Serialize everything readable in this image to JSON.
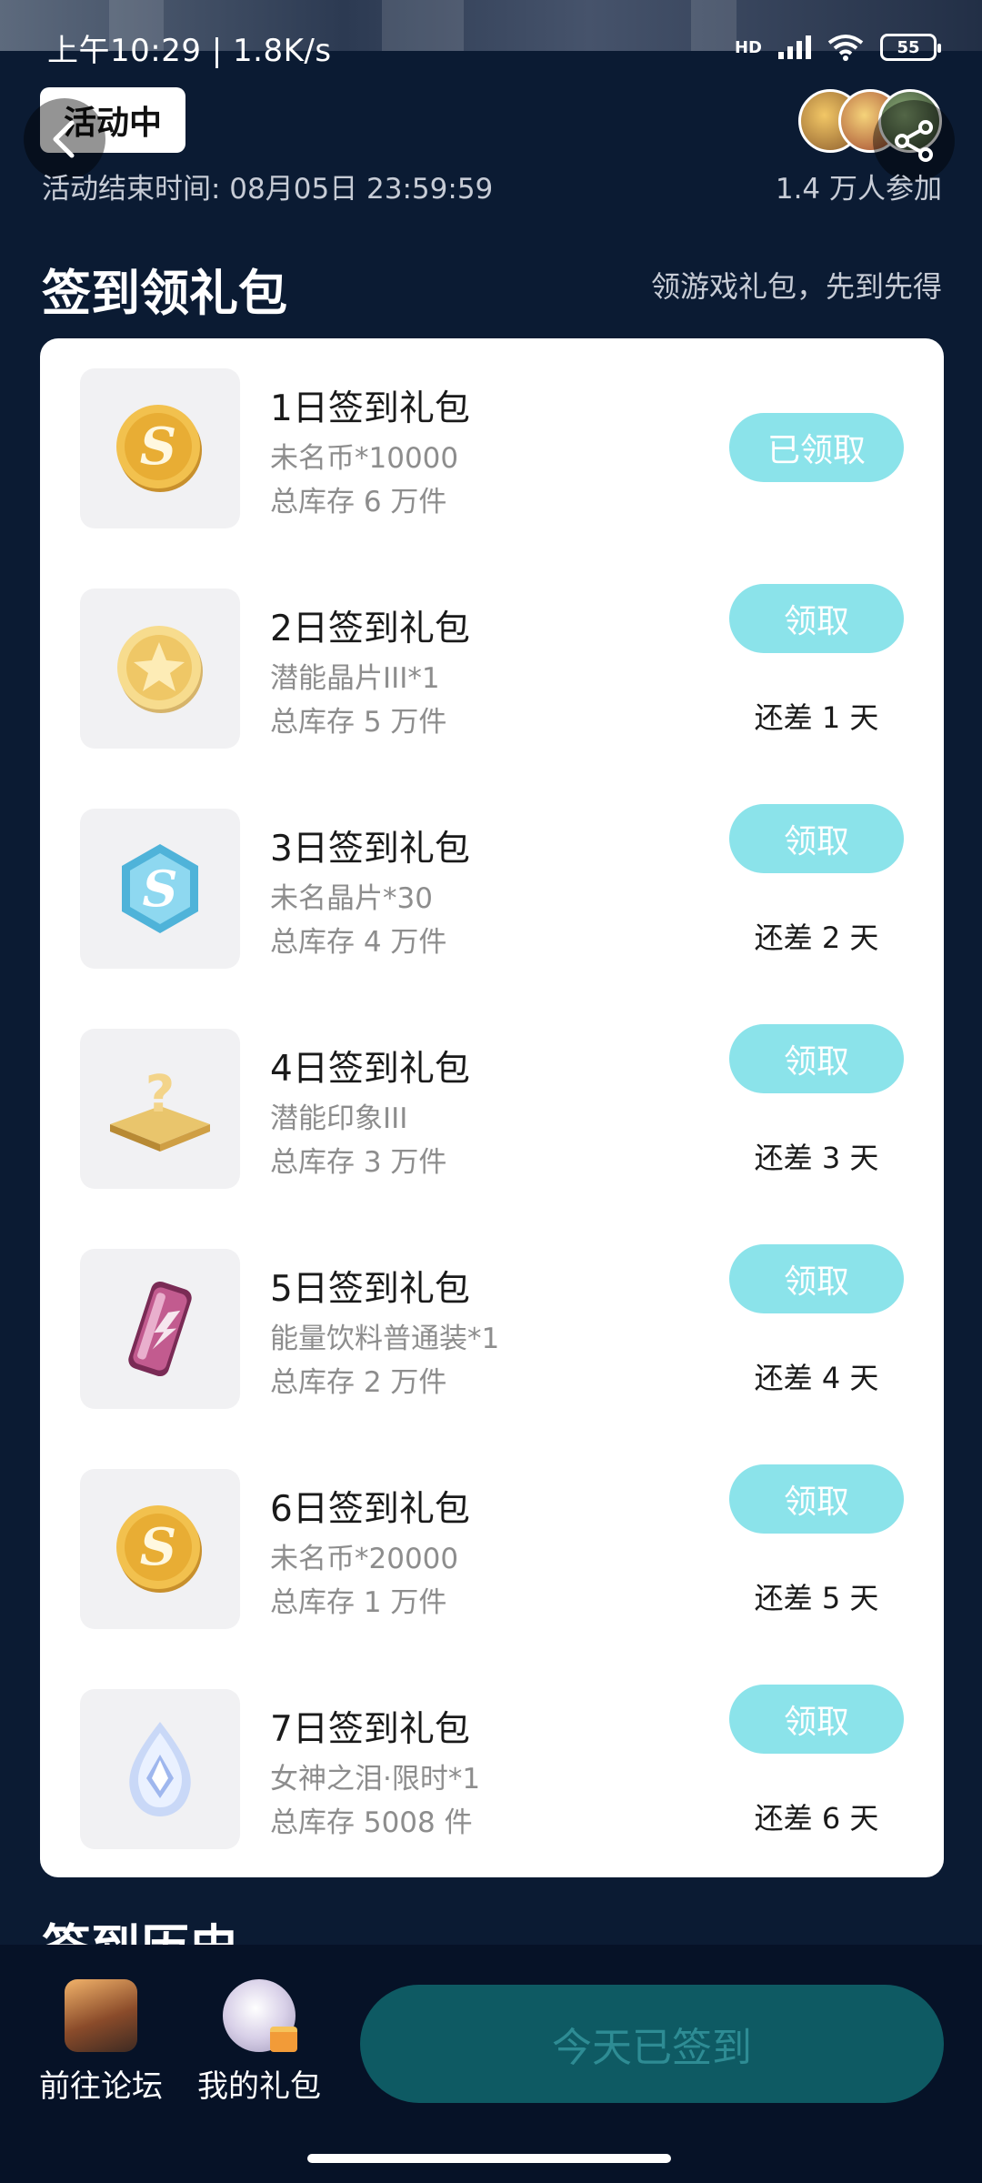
{
  "status_bar": {
    "time_speed": "上午10:29 | 1.8K/s",
    "network": "HD",
    "battery": "55"
  },
  "header": {
    "status_tag": "活动中",
    "end_time": "活动结束时间: 08月05日 23:59:59",
    "participants": "1.4 万人参加"
  },
  "section": {
    "title": "签到领礼包",
    "subtitle": "领游戏礼包，先到先得"
  },
  "gifts": [
    {
      "name": "1日签到礼包",
      "content": "未名币*10000",
      "stock": "总库存 6 万件",
      "button": "已领取",
      "remaining": "",
      "icon": "gold-s-coin-icon"
    },
    {
      "name": "2日签到礼包",
      "content": "潜能晶片III*1",
      "stock": "总库存 5 万件",
      "button": "领取",
      "remaining": "还差 1 天",
      "icon": "gold-chip-coin-icon"
    },
    {
      "name": "3日签到礼包",
      "content": "未名晶片*30",
      "stock": "总库存 4 万件",
      "button": "领取",
      "remaining": "还差 2 天",
      "icon": "blue-hexagon-s-icon"
    },
    {
      "name": "4日签到礼包",
      "content": "潜能印象III",
      "stock": "总库存 3 万件",
      "button": "领取",
      "remaining": "还差 3 天",
      "icon": "gold-question-tile-icon"
    },
    {
      "name": "5日签到礼包",
      "content": "能量饮料普通装*1",
      "stock": "总库存 2 万件",
      "button": "领取",
      "remaining": "还差 4 天",
      "icon": "energy-drink-can-icon"
    },
    {
      "name": "6日签到礼包",
      "content": "未名币*20000",
      "stock": "总库存 1 万件",
      "button": "领取",
      "remaining": "还差 5 天",
      "icon": "gold-s-coin-icon"
    },
    {
      "name": "7日签到礼包",
      "content": "女神之泪·限时*1",
      "stock": "总库存 5008 件",
      "button": "领取",
      "remaining": "还差 6 天",
      "icon": "crystal-tear-icon"
    }
  ],
  "next_section_title": "签到历史",
  "bottom_bar": {
    "forum_label": "前往论坛",
    "gifts_label": "我的礼包",
    "signed_label": "今天已签到"
  },
  "colors": {
    "page_bg": "#0b1b33",
    "button_teal": "#8be3ea",
    "signed_button_bg": "#0e5a63",
    "signed_button_text": "#2e8c94"
  }
}
